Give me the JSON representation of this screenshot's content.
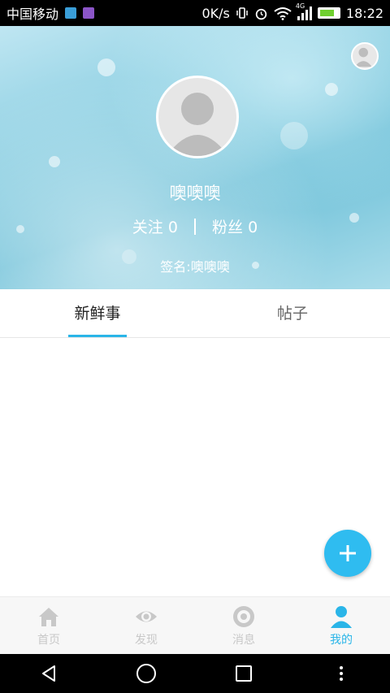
{
  "status_bar": {
    "carrier": "中国移动",
    "net_speed": "0K/s",
    "network": "4G",
    "time": "18:22",
    "icons": [
      "notification-icon",
      "image-icon",
      "vibrate-icon",
      "alarm-icon",
      "wifi-icon",
      "signal-icon",
      "battery-icon"
    ]
  },
  "profile": {
    "username": "噢噢噢",
    "follow_label": "关注",
    "follow_count": "0",
    "fans_label": "粉丝",
    "fans_count": "0",
    "signature": "签名:噢噢噢"
  },
  "tabs": [
    {
      "label": "新鲜事",
      "active": true
    },
    {
      "label": "帖子",
      "active": false
    }
  ],
  "fab": {
    "icon": "plus-icon"
  },
  "bottom_nav": [
    {
      "label": "首页",
      "icon": "home-icon",
      "active": false
    },
    {
      "label": "发现",
      "icon": "eye-icon",
      "active": false
    },
    {
      "label": "消息",
      "icon": "message-icon",
      "active": false
    },
    {
      "label": "我的",
      "icon": "person-icon",
      "active": true
    }
  ],
  "colors": {
    "accent": "#2ab5e8",
    "inactive": "#c8c8c8",
    "fab": "#2fbcf0"
  }
}
